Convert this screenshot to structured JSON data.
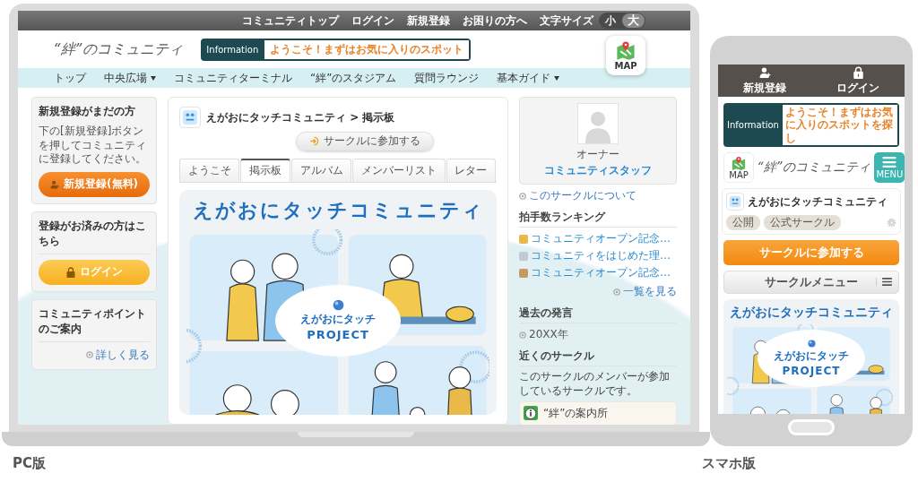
{
  "laptop": {
    "top_links": [
      "コミュニティトップ",
      "ログイン",
      "新規登録",
      "お困りの方へ"
    ],
    "font_size": {
      "label": "文字サイズ",
      "options": [
        {
          "label": "小",
          "selected": false
        },
        {
          "label": "大",
          "selected": true
        }
      ]
    },
    "logo": "“絆”のコミュニティ",
    "information": {
      "label": "Information",
      "text": "ようこそ！まずはお気に入りのスポット"
    },
    "map_label": "MAP",
    "nav": [
      {
        "label": "トップ",
        "has_dropdown": false
      },
      {
        "label": "中央広場",
        "has_dropdown": true
      },
      {
        "label": "コミュニティターミナル",
        "has_dropdown": false
      },
      {
        "label": "“絆”のスタジアム",
        "has_dropdown": false
      },
      {
        "label": "質問ラウンジ",
        "has_dropdown": false
      },
      {
        "label": "基本ガイド",
        "has_dropdown": true
      }
    ],
    "sidebar": {
      "signup": {
        "title": "新規登録がまだの方",
        "description": "下の[新規登録]ボタンを押してコミュニティに登録してください。",
        "button": "新規登録(無料)"
      },
      "login": {
        "title": "登録がお済みの方はこちら",
        "button": "ログイン"
      },
      "points": {
        "title": "コミュニティポイントのご案内",
        "link": "詳しく見る"
      }
    },
    "main": {
      "breadcrumb": "えがおにタッチコミュニティ > 掲示板",
      "join_button": "サークルに参加する",
      "tabs": [
        {
          "label": "ようこそ",
          "selected": false
        },
        {
          "label": "掲示板",
          "selected": true
        },
        {
          "label": "アルバム",
          "selected": false
        },
        {
          "label": "メンバーリスト",
          "selected": false
        },
        {
          "label": "レター",
          "selected": false
        }
      ],
      "banner": {
        "title": "えがおにタッチコミュニティ",
        "logo_line1": "えがおにタッチ",
        "logo_line2": "PROJECT"
      }
    },
    "owner": {
      "role": "オーナー",
      "name": "コミュニティスタッフ"
    },
    "about_link": "このサークルについて",
    "ranking": {
      "title": "拍手数ランキング",
      "items": [
        {
          "text": "コミュニティオープン記念…",
          "color": "#e8b84a"
        },
        {
          "text": "コミュニティをはじめた理…",
          "color": "#c4c8d4"
        },
        {
          "text": "コミュニティオープン記念…",
          "color": "#c49a62"
        }
      ],
      "more": "一覧を見る"
    },
    "past_posts": {
      "title": "過去の発言",
      "items": [
        "20XX年"
      ]
    },
    "nearby": {
      "title": "近くのサークル",
      "description": "このサークルのメンバーが参加しているサークルです。",
      "items": [
        "“絆”の案内所"
      ]
    }
  },
  "phone": {
    "top_buttons": [
      {
        "label": "新規登録",
        "kind": "signup"
      },
      {
        "label": "ログイン",
        "kind": "login"
      }
    ],
    "information": {
      "label": "Information",
      "text": "ようこそ！まずはお気に入りのスポットを探し"
    },
    "map_label": "MAP",
    "logo": "“絆”のコミュニティ",
    "menu_label": "MENU",
    "circle": {
      "title": "えがおにタッチコミュニティ",
      "tags": [
        "公開",
        "公式サークル"
      ]
    },
    "join_button": "サークルに参加する",
    "circle_menu": "サークルメニュー",
    "banner": {
      "title": "えがおにタッチコミュニティ",
      "logo_line1": "えがおにタッチ",
      "logo_line2": "PROJECT"
    }
  },
  "captions": [
    "PC版",
    "スマホ版"
  ]
}
